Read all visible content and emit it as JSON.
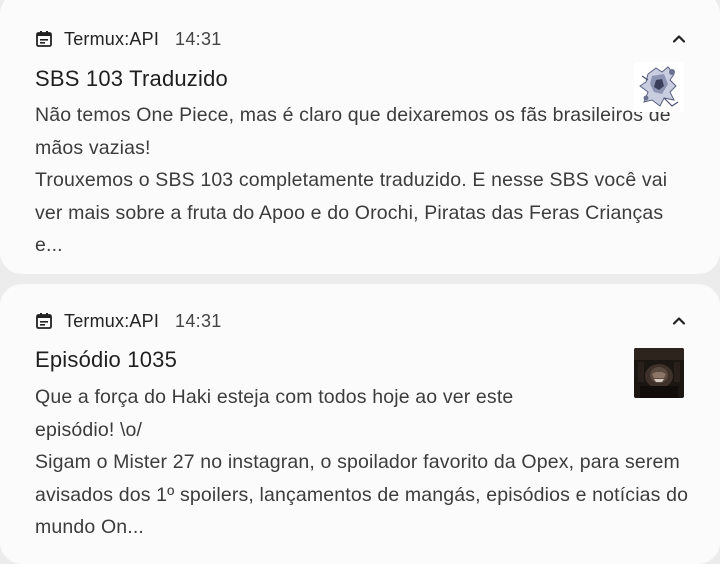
{
  "notifications": [
    {
      "app_name": "Termux:API",
      "time": "14:31",
      "title": "SBS 103 Traduzido",
      "body_line_1": "Não temos One Piece, mas é claro que deixaremos os fãs brasileiros de mãos vazias!",
      "body_line_2": "Trouxemos o SBS 103 completamente traduzido. E nesse SBS você vai ver mais sobre a fruta do Apoo e do Orochi, Piratas das Feras Crianças e...",
      "app_icon": "calendar-icon",
      "expand_icon": "chevron-up-icon",
      "thumbnail": "manga-sketch-thumbnail"
    },
    {
      "app_name": "Termux:API",
      "time": "14:31",
      "title": "Episódio 1035",
      "body_line_1": "Que a força do Haki esteja com todos hoje ao ver este episódio! \\o/",
      "body_line_2": "Sigam o Mister 27 no instagran, o spoilador favorito da Opex, para serem avisados dos 1º spoilers, lançamentos de mangás, episódios e notícias do mundo On...",
      "app_icon": "calendar-icon",
      "expand_icon": "chevron-up-icon",
      "thumbnail": "anime-dark-thumbnail"
    }
  ],
  "colors": {
    "background": "#ececec",
    "card": "#fbfbfb",
    "text_primary": "#1f1f1f",
    "text_body": "#3c3c3c"
  }
}
